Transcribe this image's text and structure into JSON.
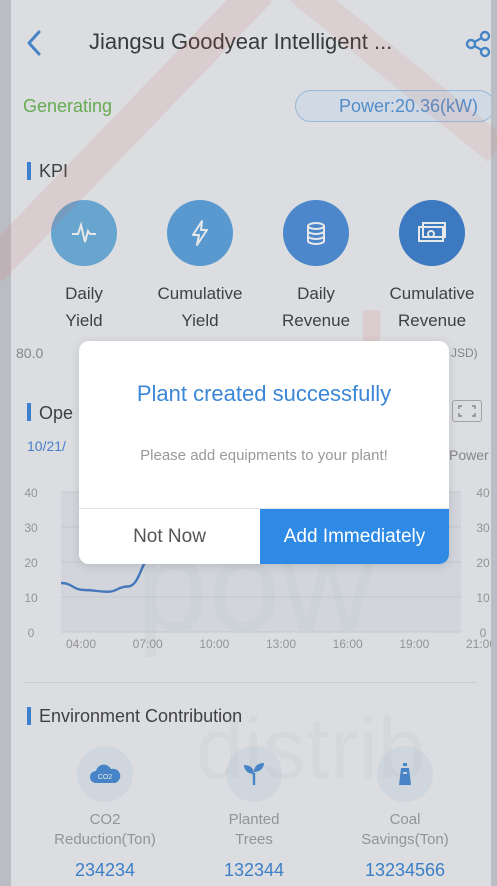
{
  "header": {
    "title": "Jiangsu Goodyear Intelligent ...",
    "back_icon": "back-arrow-icon",
    "share_icon": "share-icon"
  },
  "status": {
    "state": "Generating",
    "power": "Power:20.36(kW)",
    "state_color": "#62b546",
    "accent": "#2f7fe0"
  },
  "kpi": {
    "title": "KPI",
    "items": [
      {
        "label_1": "Daily",
        "label_2": "Yield",
        "icon": "pulse-icon",
        "color": "#5aa7de"
      },
      {
        "label_1": "Cumulative",
        "label_2": "Yield",
        "icon": "lightning-icon",
        "color": "#4e9ae0"
      },
      {
        "label_1": "Daily",
        "label_2": "Revenue",
        "icon": "coins-icon",
        "color": "#3f86d8"
      },
      {
        "label_1": "Cumulative",
        "label_2": "Revenue",
        "icon": "cash-icon",
        "color": "#2f78cf"
      }
    ],
    "visible_value_first": "80.0",
    "visible_value_last": "JSD)"
  },
  "operation": {
    "title": "Ope",
    "date": "10/21/",
    "power_axis_label": "Power"
  },
  "chart_data": {
    "type": "area",
    "x": [
      "04:00",
      "07:00",
      "10:00",
      "13:00",
      "16:00",
      "19:00",
      "21:00"
    ],
    "left_ticks": [
      "0",
      "10",
      "20",
      "30",
      "40"
    ],
    "right_ticks": [
      "0",
      "10",
      "20",
      "30",
      "40"
    ],
    "ylim": [
      0,
      40
    ],
    "series": [
      {
        "points": [
          [
            0,
            14
          ],
          [
            0.35,
            12
          ],
          [
            0.7,
            11.5
          ],
          [
            1.0,
            13
          ],
          [
            1.4,
            22
          ]
        ]
      }
    ],
    "color": "#3a76c9"
  },
  "environment": {
    "title": "Environment Contribution",
    "items": [
      {
        "label_1": "CO2",
        "label_2": "Reduction(Ton)",
        "value": "234234",
        "icon": "co2-cloud-icon",
        "color": "#3b86d6"
      },
      {
        "label_1": "Planted",
        "label_2": "Trees",
        "value": "132344",
        "icon": "sprout-icon",
        "color": "#3b86d6"
      },
      {
        "label_1": "Coal",
        "label_2": "Savings(Ton)",
        "value": "13234566",
        "icon": "coal-icon",
        "color": "#3b86d6"
      }
    ]
  },
  "watermark": {
    "big_text": "sol",
    "mid_text": "pow",
    "low_text": "distrib"
  },
  "dialog": {
    "title": "Plant created successfully",
    "message": "Please add equipments to your plant!",
    "cancel_label": "Not Now",
    "confirm_label": "Add Immediately",
    "confirm_color": "#2f8ae5"
  }
}
